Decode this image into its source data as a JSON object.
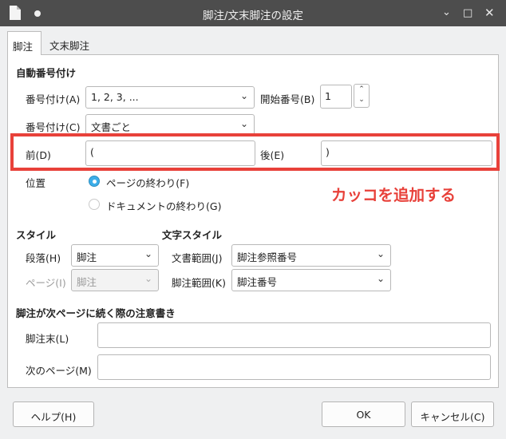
{
  "window": {
    "title": "脚注/文末脚注の設定"
  },
  "tabs": [
    {
      "label": "脚注",
      "active": true
    },
    {
      "label": "文末脚注",
      "active": false
    }
  ],
  "autonumber": {
    "heading": "自動番号付け",
    "numbering_label": "番号付け(A)",
    "numbering_value": "1, 2, 3, ...",
    "start_label": "開始番号(B)",
    "start_value": "1",
    "counting_label": "番号付け(C)",
    "counting_value": "文書ごと",
    "before_label": "前(D)",
    "before_value": "(",
    "after_label": "後(E)",
    "after_value": ")",
    "position_label": "位置",
    "position_options": [
      {
        "label": "ページの終わり(F)",
        "selected": true
      },
      {
        "label": "ドキュメントの終わり(G)",
        "selected": false
      }
    ]
  },
  "annotation_text": "カッコを追加する",
  "styles": {
    "heading": "スタイル",
    "paragraph_label": "段落(H)",
    "paragraph_value": "脚注",
    "page_label": "ページ(I)",
    "page_value": "脚注"
  },
  "char_styles": {
    "heading": "文字スタイル",
    "text_area_label": "文書範囲(J)",
    "text_area_value": "脚注参照番号",
    "footnote_area_label": "脚注範囲(K)",
    "footnote_area_value": "脚注番号"
  },
  "continuation": {
    "heading": "脚注が次ページに続く際の注意書き",
    "end_label": "脚注末(L)",
    "end_value": "",
    "next_label": "次のページ(M)",
    "next_value": ""
  },
  "buttons": {
    "help": "ヘルプ(H)",
    "ok": "OK",
    "cancel": "キャンセル(C)"
  },
  "colors": {
    "titlebar": "#4d4d4d",
    "accent": "#3daee9",
    "highlight": "#e8413a"
  },
  "icons": {
    "app": "document-icon",
    "pin": "pin-icon",
    "chevron": "chevron-down-icon",
    "spin_up": "chevron-up-icon",
    "spin_down": "chevron-down-icon"
  }
}
